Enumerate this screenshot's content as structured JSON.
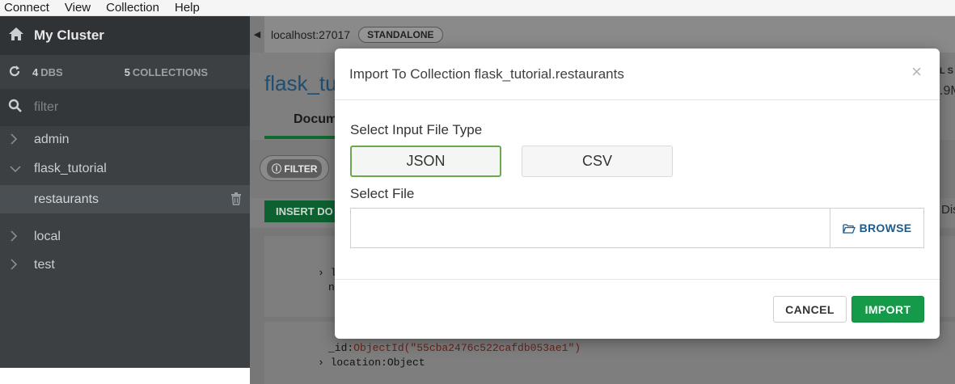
{
  "menu": {
    "items": [
      "Connect",
      "View",
      "Collection",
      "Help"
    ]
  },
  "sidebar": {
    "cluster_name": "My Cluster",
    "dbs_count": "4",
    "dbs_label": "DBS",
    "collections_count": "5",
    "collections_label": "COLLECTIONS",
    "filter_placeholder": "filter",
    "databases": [
      "admin",
      "flask_tutorial",
      "local",
      "test"
    ],
    "selected_collection": "restaurants"
  },
  "main": {
    "host": "localhost:27017",
    "topology": "STANDALONE",
    "namespace_title": "flask_tu",
    "tab_label": "Docum",
    "filter_pill": "FILTER",
    "insert_label": "INSERT DO",
    "right_frag_1": "L S",
    "right_frag_2": ".9M",
    "right_frag_3": "Dis",
    "doc_lines": {
      "l_frag": "l",
      "n_frag": "n",
      "id_key": "_id",
      "id_value": "ObjectId(\"55cba2476c522cafdb053ae1\")",
      "location_key": "location",
      "location_value": "Object"
    }
  },
  "modal": {
    "title": "Import To Collection flask_tutorial.restaurants",
    "close_glyph": "×",
    "file_type_label": "Select Input File Type",
    "json_label": "JSON",
    "csv_label": "CSV",
    "select_file_label": "Select File",
    "file_value": "",
    "browse_label": "BROWSE",
    "cancel_label": "CANCEL",
    "import_label": "IMPORT"
  },
  "colors": {
    "import_green": "#149a48",
    "selected_outline": "#69a84f",
    "browse_blue": "#1f5a8a",
    "sidebar_bg": "#3c4043"
  }
}
